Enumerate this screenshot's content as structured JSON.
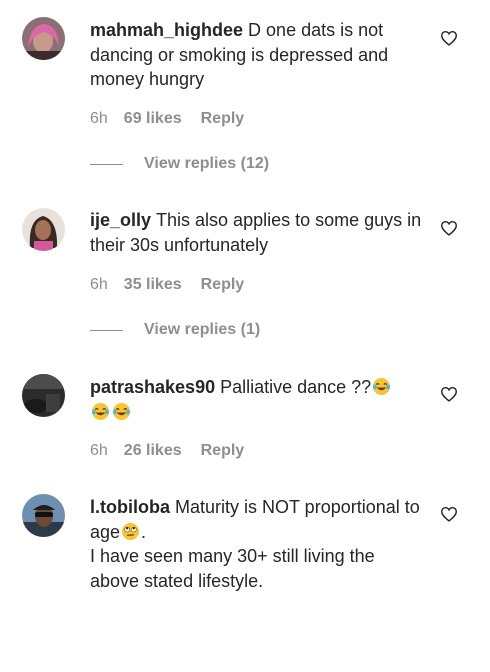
{
  "comments": [
    {
      "username": "mahmah_highdee",
      "text": "D one dats is not dancing or smoking is depressed and money hungry",
      "time": "6h",
      "likes": "69 likes",
      "reply": "Reply",
      "view_replies": "View replies (12)",
      "avatar": "woman-with-pink-hair-avatar"
    },
    {
      "username": "ije_olly",
      "text": "This also applies to some guys in their 30s unfortunately",
      "time": "6h",
      "likes": "35 likes",
      "reply": "Reply",
      "view_replies": "View replies (1)",
      "avatar": "woman-with-braids-avatar"
    },
    {
      "username": "patrashakes90",
      "text": "Palliative dance ??",
      "emojis": [
        "face-with-tears-of-joy",
        "face-with-tears-of-joy",
        "face-with-tears-of-joy"
      ],
      "time": "6h",
      "likes": "26 likes",
      "reply": "Reply",
      "avatar": "dark-photo-avatar"
    },
    {
      "username": "l.tobiloba",
      "text_part1": "Maturity is NOT proportional to age",
      "emoji": "face-with-rolling-eyes",
      "text_part2": ".",
      "text_part3": "I have seen many 30+ still living the above stated lifestyle.",
      "avatar": "man-with-sunglasses-avatar"
    }
  ],
  "icons": {
    "like": "heart-outline-icon"
  },
  "colors": {
    "text": "#262626",
    "secondary": "#8e8e8e",
    "background": "#ffffff"
  }
}
